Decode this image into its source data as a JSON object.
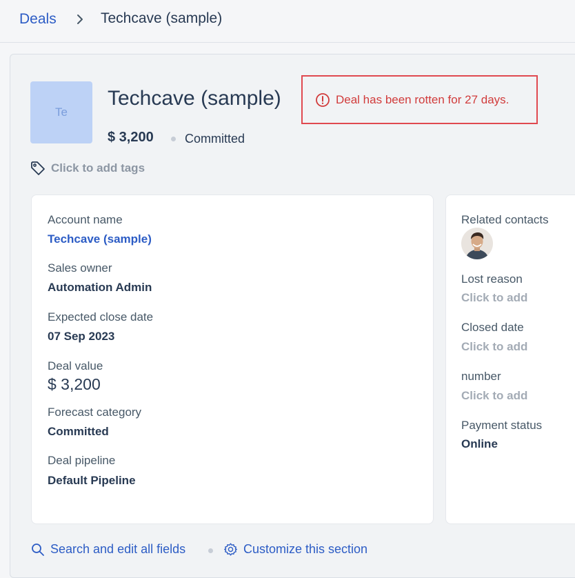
{
  "breadcrumb": {
    "parent": "Deals",
    "current": "Techcave (sample)"
  },
  "deal": {
    "avatar_initials": "Te",
    "title": "Techcave (sample)",
    "amount": "$ 3,200",
    "stage": "Committed",
    "rotten_alert": "Deal has been rotten for 27 days.",
    "tags_placeholder": "Click to add tags"
  },
  "fields_left": {
    "account_name_label": "Account name",
    "account_name_value": "Techcave (sample)",
    "sales_owner_label": "Sales owner",
    "sales_owner_value": "Automation Admin",
    "close_date_label": "Expected close date",
    "close_date_value": "07 Sep 2023",
    "deal_value_label": "Deal value",
    "deal_value_value": "$ 3,200",
    "forecast_label": "Forecast category",
    "forecast_value": "Committed",
    "pipeline_label": "Deal pipeline",
    "pipeline_value": "Default Pipeline"
  },
  "fields_right": {
    "related_contacts_label": "Related contacts",
    "lost_reason_label": "Lost reason",
    "lost_reason_value": "Click to add",
    "closed_date_label": "Closed date",
    "closed_date_value": "Click to add",
    "number_label": "number",
    "number_value": "Click to add",
    "payment_status_label": "Payment status",
    "payment_status_value": "Online"
  },
  "actions": {
    "search_edit": "Search and edit all fields",
    "customize": "Customize this section"
  },
  "icons": {
    "chevron": "chevron-right-icon",
    "alert": "alert-circle-icon",
    "tag": "tag-icon",
    "search": "search-icon",
    "gear": "gear-icon"
  },
  "colors": {
    "link": "#2c5cc5",
    "alert": "#d13b3b",
    "avatar_bg": "#bdd2f6"
  }
}
